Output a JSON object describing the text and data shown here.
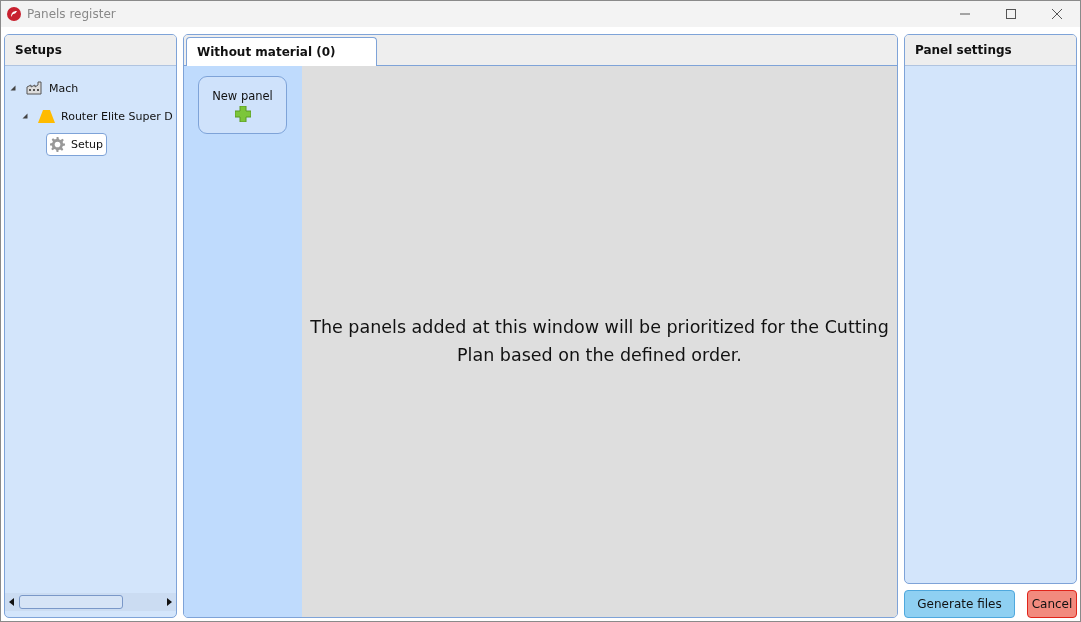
{
  "window": {
    "title": "Panels register"
  },
  "setups": {
    "title": "Setups",
    "tree": [
      {
        "label": "Mach",
        "expanded": true,
        "selected": false,
        "children": [
          {
            "label": "Router Elite Super D",
            "expanded": true,
            "selected": false,
            "children": [
              {
                "label": "Setup",
                "selected": true
              }
            ]
          }
        ]
      }
    ]
  },
  "tabs": [
    {
      "label": "Without material (0)",
      "selected": true
    }
  ],
  "new_panel": {
    "label": "New panel"
  },
  "message": "The panels added at this window will be prioritized for the Cutting Plan based on the defined order.",
  "panel_settings": {
    "title": "Panel settings"
  },
  "buttons": [
    {
      "label": "Generate files",
      "kind": "primary"
    },
    {
      "label": "Cancel",
      "kind": "danger"
    }
  ]
}
